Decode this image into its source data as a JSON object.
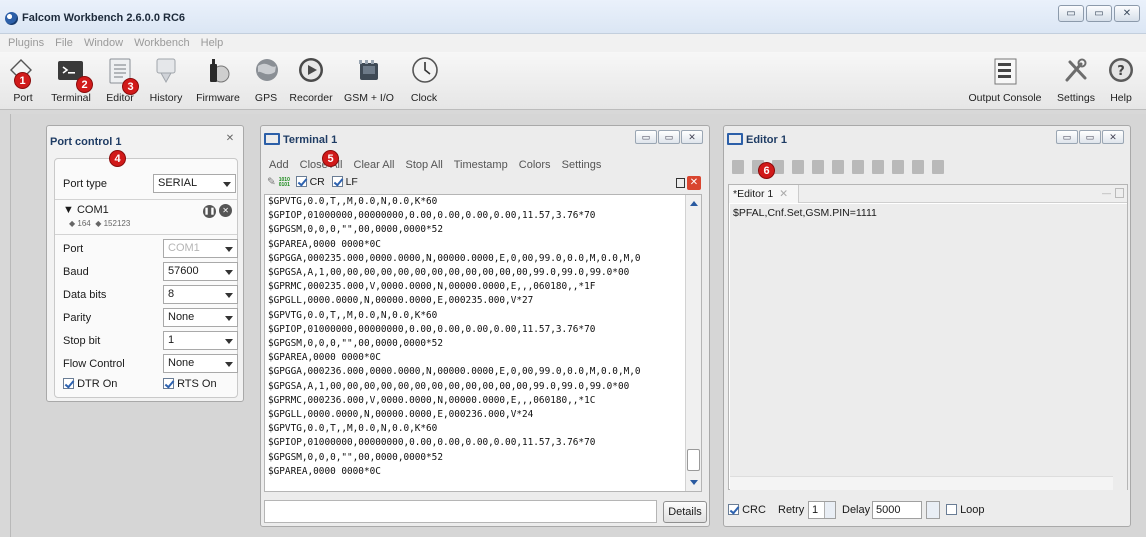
{
  "window": {
    "title": "Falcom Workbench 2.6.0.0 RC6",
    "controls": [
      "▭",
      "▭",
      "✕"
    ]
  },
  "menu": [
    "Plugins",
    "File",
    "Window",
    "Workbench",
    "Help"
  ],
  "toolbar": {
    "left": [
      {
        "label": "Port",
        "icon": "port-icon",
        "badge": "1"
      },
      {
        "label": "Terminal",
        "icon": "terminal-icon",
        "badge": "2"
      },
      {
        "label": "Editor",
        "icon": "editor-icon",
        "badge": "3"
      },
      {
        "label": "History",
        "icon": "history-icon"
      },
      {
        "label": "Firmware",
        "icon": "firmware-icon"
      },
      {
        "label": "GPS",
        "icon": "gps-icon"
      },
      {
        "label": "Recorder",
        "icon": "recorder-icon"
      },
      {
        "label": "GSM + I/O",
        "icon": "gsm-io-icon"
      },
      {
        "label": "Clock",
        "icon": "clock-icon"
      }
    ],
    "right": [
      {
        "label": "Output Console",
        "icon": "output-console-icon"
      },
      {
        "label": "Settings",
        "icon": "settings-icon"
      },
      {
        "label": "Help",
        "icon": "help-icon"
      }
    ]
  },
  "callouts": {
    "port_panel": "4",
    "terminal_panel": "5",
    "editor_panel": "6"
  },
  "port_control": {
    "title": "Port control 1",
    "port_type_label": "Port type",
    "port_type_value": "SERIAL",
    "device": "COM1",
    "rx_count": "164",
    "tx_count": "152123",
    "fields": [
      {
        "label": "Port",
        "value": "COM1",
        "disabled": true
      },
      {
        "label": "Baud",
        "value": "57600"
      },
      {
        "label": "Data bits",
        "value": "8"
      },
      {
        "label": "Parity",
        "value": "None"
      },
      {
        "label": "Stop bit",
        "value": "1"
      },
      {
        "label": "Flow Control",
        "value": "None"
      }
    ],
    "dtr_label": "DTR On",
    "rts_label": "RTS On"
  },
  "terminal": {
    "title": "Terminal 1",
    "menu": [
      "Add",
      "Close All",
      "Clear All",
      "Stop All",
      "Timestamp",
      "Colors",
      "Settings"
    ],
    "hex_icon_label": "1010 0101",
    "cr_label": "CR",
    "lf_label": "LF",
    "details_label": "Details",
    "lines": [
      "$GPVTG,0.0,T,,M,0.0,N,0.0,K*60",
      "$GPIOP,01000000,00000000,0.00,0.00,0.00,0.00,11.57,3.76*70",
      "$GPGSM,0,0,0,\"\",00,0000,0000*52",
      "$GPAREA,0000 0000*0C",
      "$GPGGA,000235.000,0000.0000,N,00000.0000,E,0,00,99.0,0.0,M,0.0,M,0",
      "$GPGSA,A,1,00,00,00,00,00,00,00,00,00,00,00,00,99.0,99.0,99.0*00",
      "$GPRMC,000235.000,V,0000.0000,N,00000.0000,E,,,060180,,*1F",
      "$GPGLL,0000.0000,N,00000.0000,E,000235.000,V*27",
      "$GPVTG,0.0,T,,M,0.0,N,0.0,K*60",
      "$GPIOP,01000000,00000000,0.00,0.00,0.00,0.00,11.57,3.76*70",
      "$GPGSM,0,0,0,\"\",00,0000,0000*52",
      "$GPAREA,0000 0000*0C",
      "$GPGGA,000236.000,0000.0000,N,00000.0000,E,0,00,99.0,0.0,M,0.0,M,0",
      "$GPGSA,A,1,00,00,00,00,00,00,00,00,00,00,00,00,99.0,99.0,99.0*00",
      "$GPRMC,000236.000,V,0000.0000,N,00000.0000,E,,,060180,,*1C",
      "$GPGLL,0000.0000,N,00000.0000,E,000236.000,V*24",
      "$GPVTG,0.0,T,,M,0.0,N,0.0,K*60",
      "$GPIOP,01000000,00000000,0.00,0.00,0.00,0.00,11.57,3.76*70",
      "$GPGSM,0,0,0,\"\",00,0000,0000*52",
      "$GPAREA,0000 0000*0C"
    ]
  },
  "editor": {
    "title": "Editor 1",
    "tab_label": "*Editor 1",
    "content": "$PFAL,Cnf.Set,GSM.PIN=1111",
    "crc_label": "CRC",
    "retry_label": "Retry",
    "retry_value": "1",
    "delay_label": "Delay",
    "delay_value": "5000",
    "loop_label": "Loop"
  }
}
